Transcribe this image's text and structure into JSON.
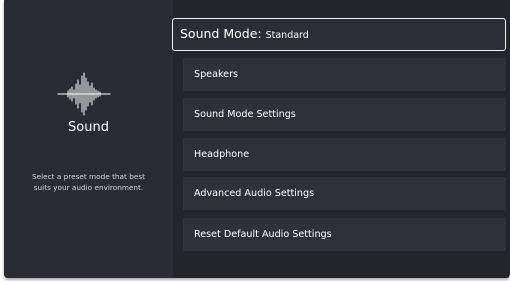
{
  "side_panel": {
    "icon": "sound-waveform-icon",
    "title": "Sound",
    "description_line1": "Select a preset mode that best",
    "description_line2": "suits your audio environment."
  },
  "menu": {
    "header_label": "Sound Mode:",
    "header_value": "Standard",
    "items": [
      {
        "label": "Speakers"
      },
      {
        "label": "Sound Mode Settings"
      },
      {
        "label": "Headphone"
      },
      {
        "label": "Advanced Audio Settings"
      },
      {
        "label": "Reset Default Audio Settings"
      }
    ]
  },
  "colors": {
    "background_left": "#2a2c33",
    "background_right": "#23252b",
    "item_background": "#2f3138",
    "focus_border": "#f2f2f2",
    "text": "#ffffff"
  }
}
